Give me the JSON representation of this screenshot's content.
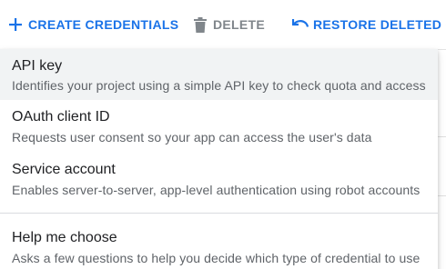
{
  "toolbar": {
    "create_label": "CREATE CREDENTIALS",
    "delete_label": "DELETE",
    "restore_label": "RESTORE DELETED CR"
  },
  "menu": {
    "items": [
      {
        "title": "API key",
        "description": "Identifies your project using a simple API key to check quota and access"
      },
      {
        "title": "OAuth client ID",
        "description": "Requests user consent so your app can access the user's data"
      },
      {
        "title": "Service account",
        "description": "Enables server-to-server, app-level authentication using robot accounts"
      },
      {
        "title": "Help me choose",
        "description": "Asks a few questions to help you decide which type of credential to use"
      }
    ]
  },
  "colors": {
    "accent": "#1a73e8",
    "disabled": "#80868b",
    "hover": "#f1f3f4",
    "title_text": "#202124",
    "desc_text": "#5f6368"
  }
}
